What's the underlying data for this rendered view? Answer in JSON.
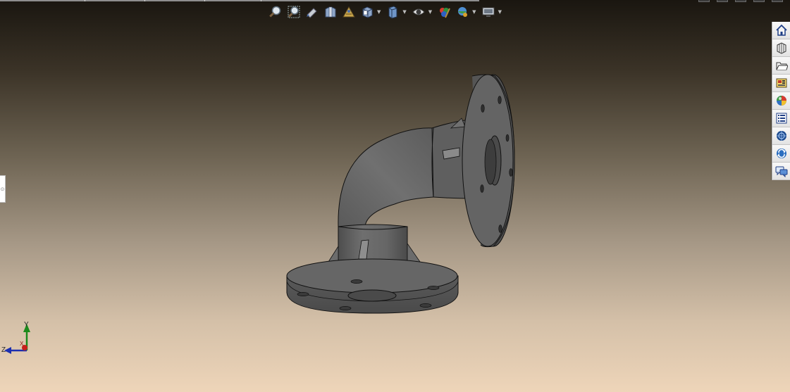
{
  "toolbar": {
    "items": [
      {
        "name": "zoom-to-fit"
      },
      {
        "name": "zoom-to-area"
      },
      {
        "name": "previous-view"
      },
      {
        "name": "section-view"
      },
      {
        "name": "dynamic-annotation-views"
      },
      {
        "name": "view-orientation",
        "dropdown": true
      },
      {
        "name": "display-style",
        "dropdown": true
      },
      {
        "name": "hide-show-items",
        "dropdown": true
      },
      {
        "name": "edit-appearance"
      },
      {
        "name": "apply-scene",
        "dropdown": true
      },
      {
        "name": "view-settings",
        "dropdown": true
      }
    ],
    "dropdown_glyph": "▼"
  },
  "task_pane": {
    "tabs": [
      "home",
      "design-library",
      "file-explorer",
      "view-palette",
      "appearances",
      "custom-properties",
      "3dcontentcentral",
      "solidworks-forum",
      "forum"
    ]
  },
  "left_panel_toggle": {
    "glyph": "⊙"
  },
  "triad": {
    "y_label": "Y",
    "z_label": "Z",
    "x_label": "X"
  },
  "colors": {
    "model_fill": "#626262",
    "model_edge": "#111111",
    "y_axis": "#1c8a1c",
    "z_axis": "#1c2fb0",
    "x_axis": "#c8201c"
  }
}
